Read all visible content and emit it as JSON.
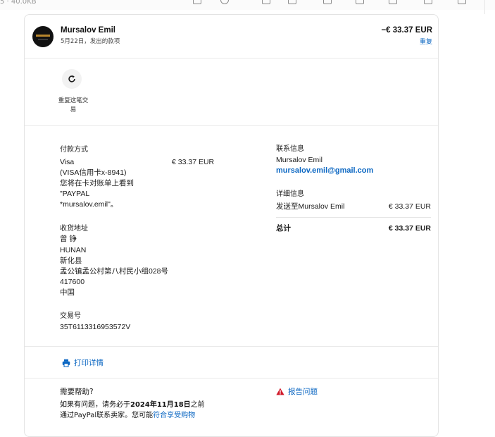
{
  "top_bar": {
    "file_meta": "5 · 40.0KB"
  },
  "header": {
    "merchant_name": "Mursalov Emil",
    "subline": "5月22日，发出的款项",
    "amount": "−€ 33.37 EUR",
    "repeat_link": "重复"
  },
  "repeat_action": {
    "label": "重复这笔交易"
  },
  "payment": {
    "label": "付款方式",
    "card_name": "Visa",
    "amount": "€ 33.37 EUR",
    "card_detail": "(VISA信用卡x-8941)",
    "statement_note_line1": "您将在卡对账单上看到",
    "statement_note_line2": "\"PAYPAL",
    "statement_note_line3": "*mursalov.emil\"。"
  },
  "shipping": {
    "label": "收货地址",
    "name": "曾 铮",
    "lines": [
      "HUNAN",
      "新化县",
      "孟公镇孟公村第八村民小组028号",
      "417600",
      "中国"
    ]
  },
  "transaction": {
    "label": "交易号",
    "id": "35T6113316953572V"
  },
  "contact": {
    "label": "联系信息",
    "name": "Mursalov Emil",
    "email": "mursalov.emil@gmail.com"
  },
  "details": {
    "label": "详细信息",
    "sent_to": "发送至Mursalov Emil",
    "sent_amount": "€ 33.37 EUR",
    "total_label": "总计",
    "total_amount": "€ 33.37 EUR"
  },
  "print": {
    "label": "打印详情"
  },
  "help": {
    "title": "需要帮助?",
    "text_prefix": "如果有问题，请务必于",
    "deadline": "2024年11月18日",
    "text_suffix": "之前",
    "line2_prefix": "通过PayPal联系卖家。您可能",
    "line2_link": "符合享受购物",
    "report_label": "报告问题"
  },
  "colors": {
    "link": "#0a66c2",
    "warning": "#d11a2a"
  }
}
